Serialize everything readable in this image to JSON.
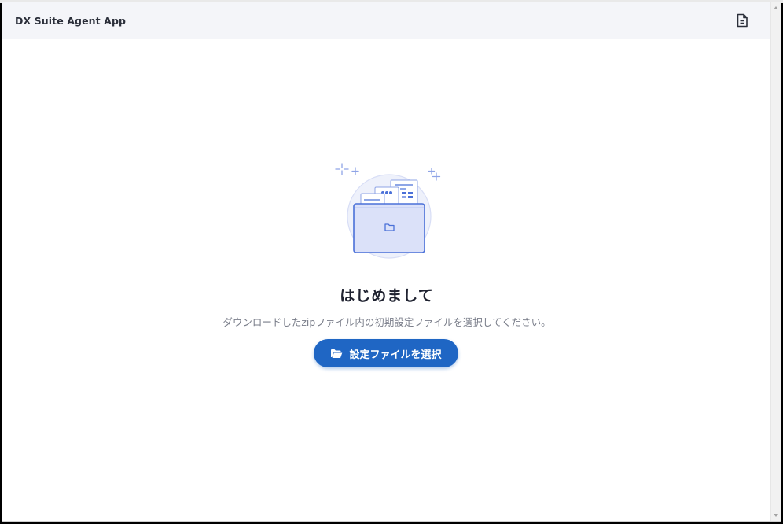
{
  "header": {
    "title": "DX Suite Agent App",
    "doc_icon": "document-icon"
  },
  "main": {
    "heading": "はじめまして",
    "description": "ダウンロードしたzipファイル内の初期設定ファイルを選択してください。",
    "button": {
      "label": "設定ファイルを選択",
      "icon": "folder-open-icon"
    },
    "illustration_icon": "folder-illustration-icon"
  },
  "colors": {
    "accent": "#1f66c4",
    "header_bg": "#f4f5f9",
    "illustration_stroke": "#4a70d8",
    "illustration_fill": "#dbe1f9"
  }
}
